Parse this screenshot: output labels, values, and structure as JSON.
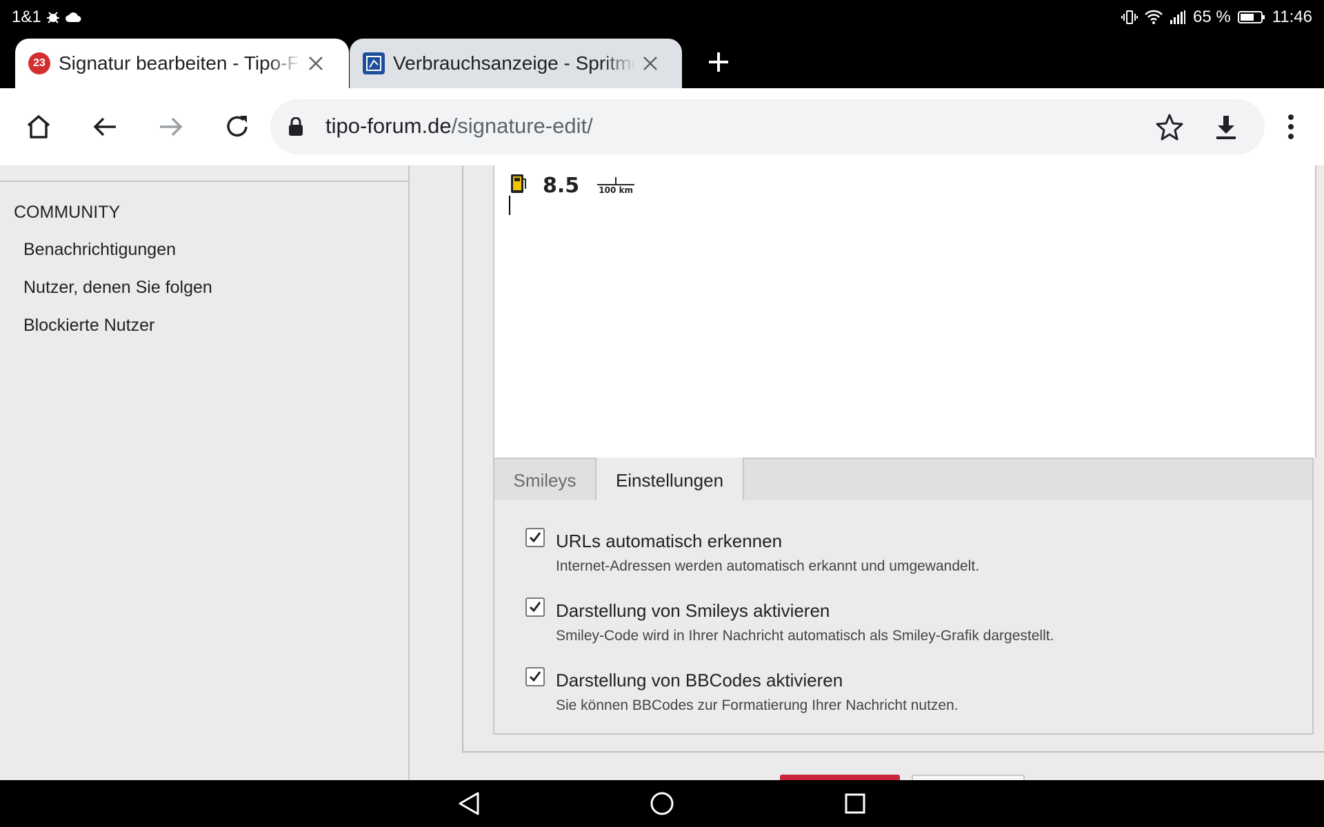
{
  "status_bar": {
    "carrier": "1&1",
    "battery_percent": "65 %",
    "time": "11:46"
  },
  "tabs": [
    {
      "title": "Signatur bearbeiten - Tipo-Forum",
      "favicon_text": "23",
      "active": true
    },
    {
      "title": "Verbrauchsanzeige - Spritmonitor",
      "active": false
    }
  ],
  "omnibox": {
    "domain": "tipo-forum.de",
    "path": "/signature-edit/"
  },
  "sidebar": {
    "section_title": "COMMUNITY",
    "items": [
      {
        "label": "Benachrichtigungen"
      },
      {
        "label": "Nutzer, denen Sie folgen"
      },
      {
        "label": "Blockierte Nutzer"
      }
    ]
  },
  "signature": {
    "consumption_value": "8.5",
    "unit_top": "l",
    "unit_bottom": "100 km"
  },
  "form_tabs": {
    "smileys": "Smileys",
    "settings": "Einstellungen"
  },
  "options": [
    {
      "label": "URLs automatisch erkennen",
      "description": "Internet-Adressen werden automatisch erkannt und umgewandelt.",
      "checked": true
    },
    {
      "label": "Darstellung von Smileys aktivieren",
      "description": "Smiley-Code wird in Ihrer Nachricht automatisch als Smiley-Grafik dargestellt.",
      "checked": true
    },
    {
      "label": "Darstellung von BBCodes aktivieren",
      "description": "Sie können BBCodes zur Formatierung Ihrer Nachricht nutzen.",
      "checked": true
    }
  ],
  "colors": {
    "primary_button": "#c8253b",
    "favicon_red": "#d32f2f",
    "fuel_yellow": "#f2c300"
  }
}
